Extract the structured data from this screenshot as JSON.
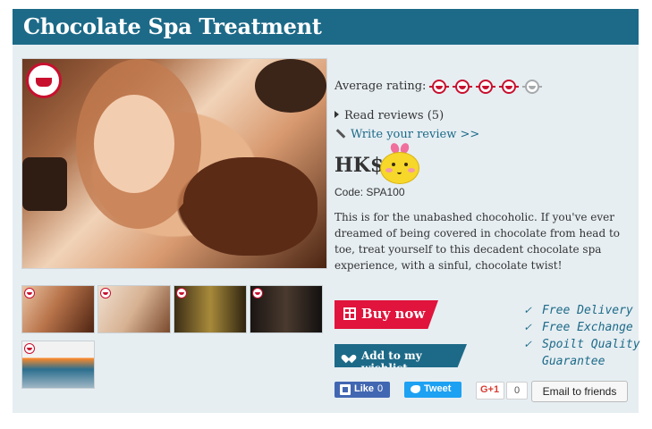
{
  "product": {
    "title": "Chocolate Spa Treatment",
    "rating_label": "Average rating:",
    "rating_value": 4,
    "rating_max": 5,
    "read_reviews": "Read reviews (5)",
    "write_review": "Write your review >>",
    "price": "HK$",
    "code": "Code: SPA100",
    "description": "This is for the unabashed chocoholic. If you've ever dreamed of being covered in chocolate from head to toe, treat yourself to this decadent chocolate spa experience, with a sinful, chocolate twist!"
  },
  "actions": {
    "buy_now": "Buy now",
    "add_wishlist": "Add to my wishlist",
    "facebook_like": "Like",
    "facebook_count": "0",
    "tweet": "Tweet",
    "gplus": "G+1",
    "gplus_count": "0",
    "email_friends": "Email to friends"
  },
  "features": {
    "check_symbol": "✓",
    "items": [
      "Free Delivery",
      "Free Exchange",
      "Spoilt Quality",
      "Guarantee"
    ]
  },
  "icons": {
    "logo": "teapot-logo-icon",
    "rating": "teapot-rating-icon",
    "gift": "gift-icon",
    "heart": "heart-icon",
    "pencil": "pencil-icon",
    "facebook": "facebook-icon",
    "twitter": "twitter-icon",
    "emoji": "smiley-sticker-icon"
  },
  "colors": {
    "title_bar": "#1d6a88",
    "buy_now": "#e0143c",
    "rating_active": "#c8102e",
    "rating_inactive": "#a6aaad",
    "facebook": "#4267b2",
    "twitter": "#1da1f2"
  }
}
